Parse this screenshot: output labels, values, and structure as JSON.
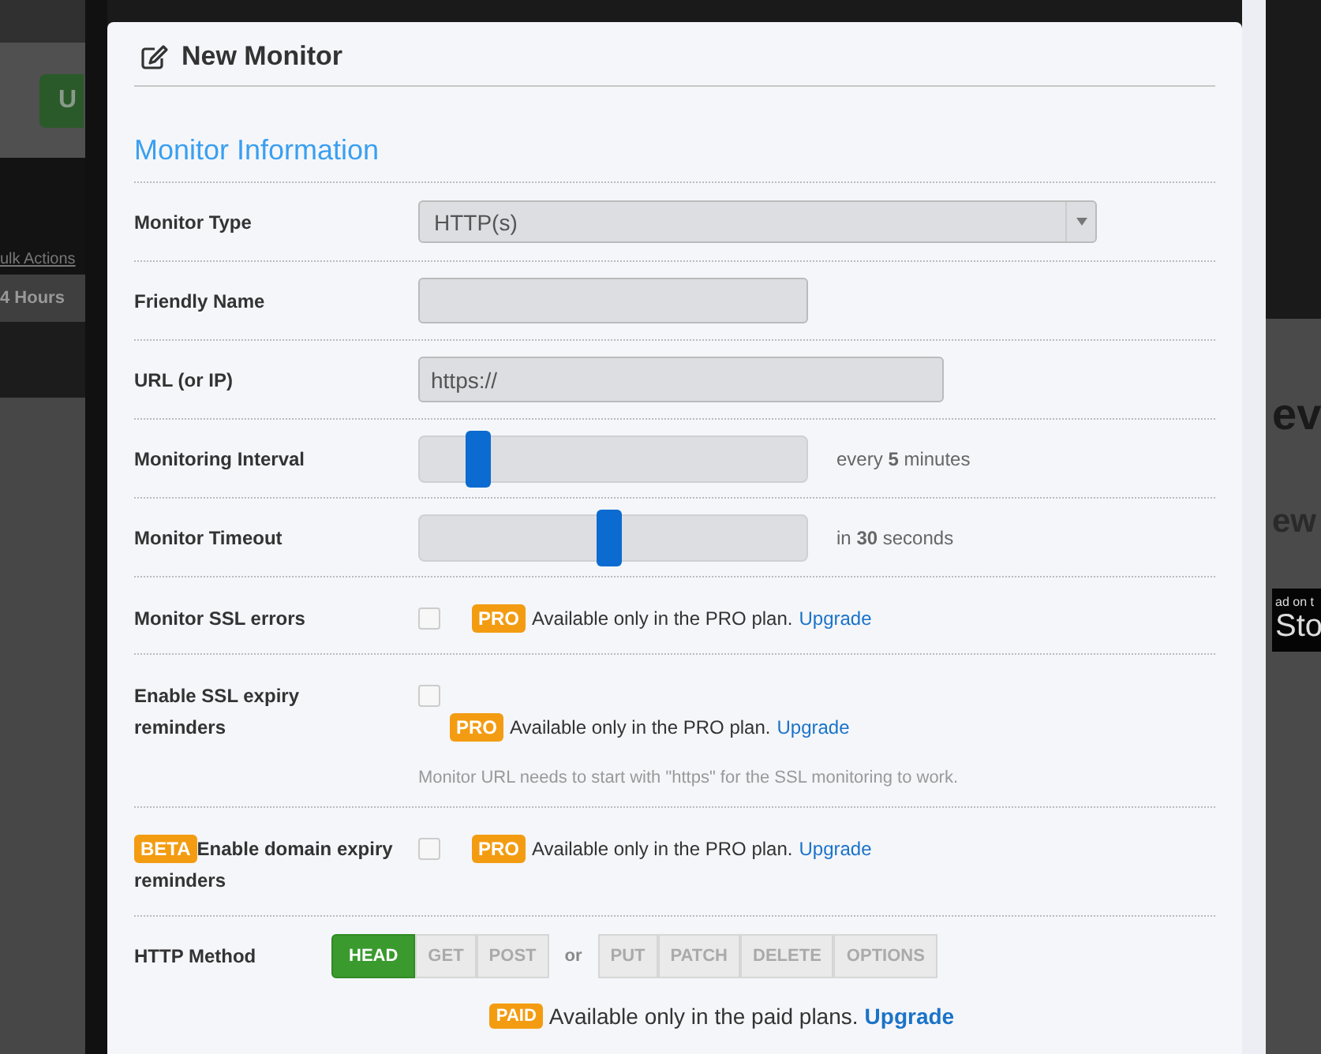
{
  "background": {
    "button": "U",
    "bulk_actions": "ulk Actions",
    "period": "4 Hours",
    "headline_1": "ev",
    "headline_2": "ew",
    "store_badge": {
      "line_1": "ad on t",
      "line_2": "Sto"
    }
  },
  "modal": {
    "title": "New Monitor",
    "section": "Monitor Information",
    "fields": [
      {
        "kind": "select",
        "label": "Monitor Type",
        "value": "HTTP(s)"
      },
      {
        "kind": "name",
        "label": "Friendly Name"
      },
      {
        "kind": "url",
        "label": "URL (or IP)",
        "value": "https://"
      },
      {
        "kind": "slider",
        "label": "Monitoring Interval",
        "level": 0.15,
        "reading": "every **5** minutes"
      },
      {
        "kind": "slider",
        "label": "Monitor Timeout",
        "level": 0.49,
        "reading": "in **30** seconds"
      },
      {
        "kind": "checkbox",
        "label": "Monitor SSL errors",
        "checked": false,
        "badge": "PRO",
        "note": "Available only in the PRO plan.",
        "link": "Upgrade"
      },
      {
        "kind": "checkbox-stacked",
        "label": "Enable SSL expiry reminders",
        "checked": false,
        "badge": "PRO",
        "note": "Available only in the PRO plan.",
        "link": "Upgrade",
        "hint": "Monitor URL needs to start with \"https\" for the SSL monitoring to work."
      },
      {
        "kind": "checkbox",
        "label_badge": "BETA",
        "label": "Enable domain expiry reminders",
        "checked": false,
        "badge": "PRO",
        "note": "Available only in the PRO plan.",
        "link": "Upgrade"
      },
      {
        "kind": "methods",
        "label": "HTTP Method",
        "separator": "or",
        "badge": "PAID",
        "note": "Available only in the paid plans.",
        "link": "Upgrade",
        "groups": [
          [
            {
              "label": "HEAD",
              "selected": true
            },
            {
              "label": "GET",
              "selected": false
            },
            {
              "label": "POST",
              "selected": false
            }
          ],
          [
            {
              "label": "PUT",
              "selected": false
            },
            {
              "label": "PATCH",
              "selected": false
            },
            {
              "label": "DELETE",
              "selected": false
            },
            {
              "label": "OPTIONS",
              "selected": false
            }
          ]
        ]
      }
    ]
  }
}
